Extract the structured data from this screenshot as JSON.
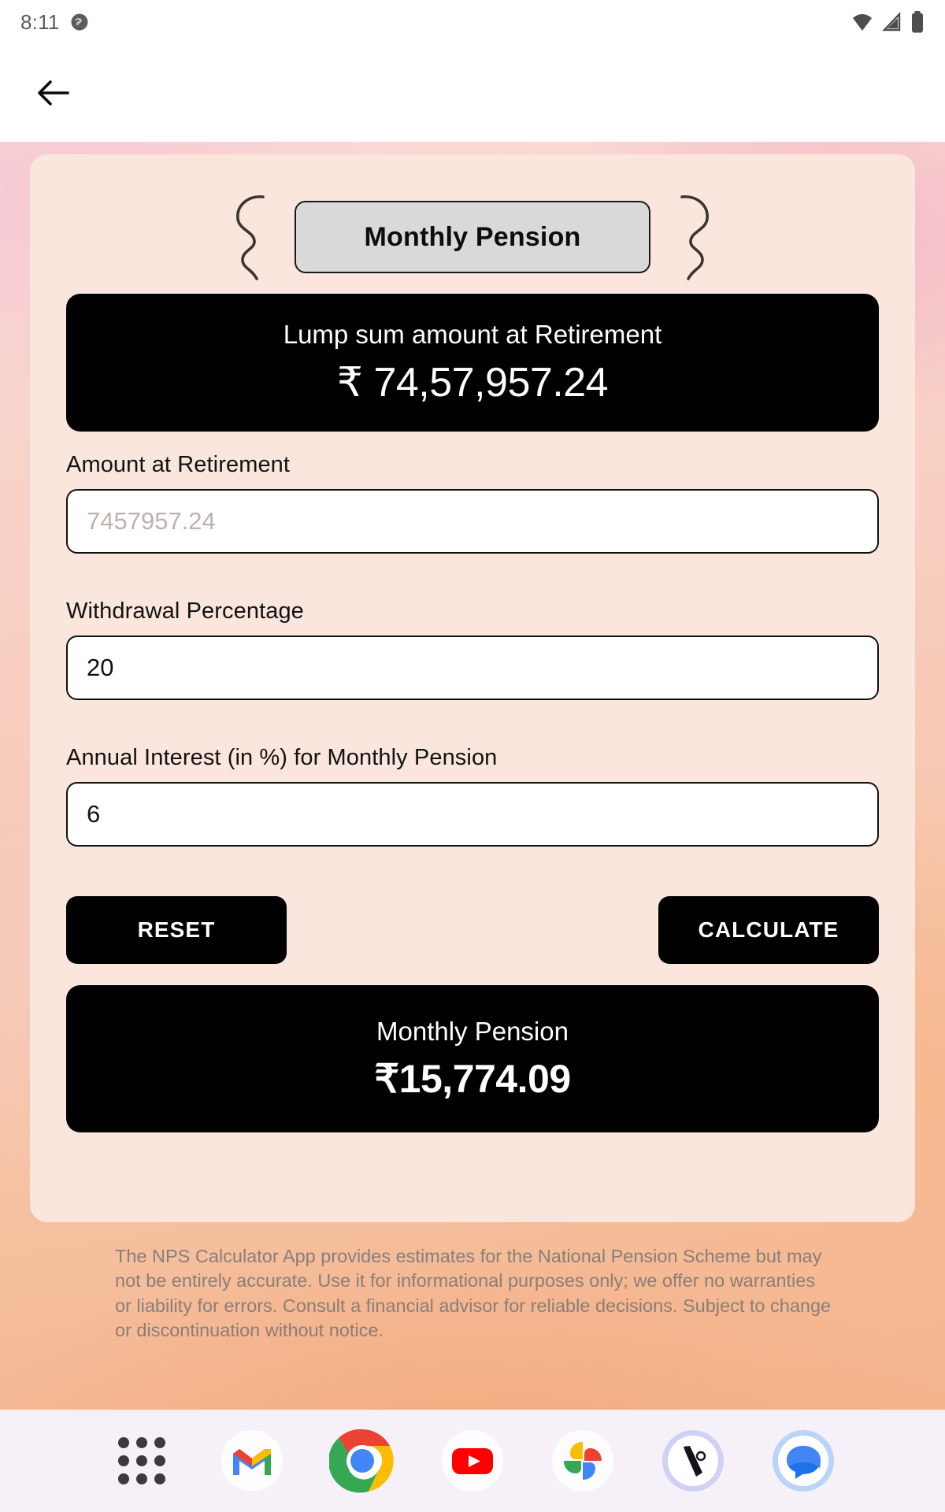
{
  "status_bar": {
    "time": "8:11",
    "icons": [
      "chat-bubble-icon",
      "wifi-icon",
      "cellular-signal-icon",
      "battery-icon"
    ]
  },
  "app_bar": {
    "back_icon": "arrow-left-icon"
  },
  "screen": {
    "title": "Monthly Pension",
    "decoration_left": "squiggle-left",
    "decoration_right": "squiggle-right"
  },
  "lump_sum_card": {
    "label": "Lump sum amount at Retirement",
    "value": "₹ 74,57,957.24"
  },
  "form": {
    "fields": [
      {
        "label": "Amount at Retirement",
        "value": "",
        "placeholder": "7457957.24"
      },
      {
        "label": "Withdrawal Percentage",
        "value": "20",
        "placeholder": ""
      },
      {
        "label": "Annual Interest (in %) for Monthly Pension",
        "value": "6",
        "placeholder": ""
      }
    ]
  },
  "actions": {
    "reset_label": "RESET",
    "calculate_label": "CALCULATE"
  },
  "pension_card": {
    "label": "Monthly Pension",
    "value": "₹15,774.09"
  },
  "disclaimer": {
    "text": "The NPS Calculator App provides estimates for the National Pension Scheme but may not be entirely accurate. Use it for informational purposes only; we offer no warranties or liability for errors. Consult a financial advisor for reliable decisions. Subject to change or discontinuation without notice."
  },
  "dock": {
    "items": [
      {
        "name": "app-drawer-icon",
        "label": "App drawer"
      },
      {
        "name": "gmail-icon",
        "label": "Gmail"
      },
      {
        "name": "chrome-icon",
        "label": "Chrome"
      },
      {
        "name": "youtube-icon",
        "label": "YouTube"
      },
      {
        "name": "google-photos-icon",
        "label": "Photos"
      },
      {
        "name": "device-setup-icon",
        "label": "Switch to Android"
      },
      {
        "name": "google-messages-icon",
        "label": "Messages"
      }
    ]
  },
  "colors": {
    "card_bg": "#fae6dc",
    "result_bg": "#000000",
    "chip_bg": "#d9d9d9",
    "dock_bg": "#f6f0f8",
    "disclaimer_text": "#8a7e78"
  }
}
